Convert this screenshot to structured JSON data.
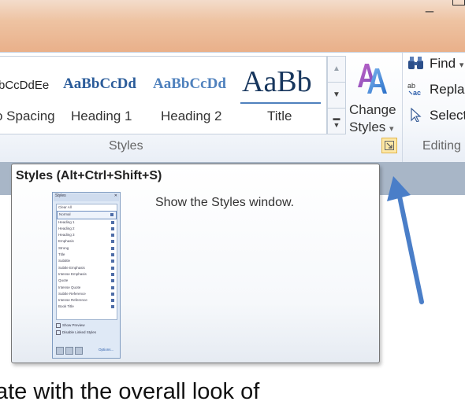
{
  "ribbon": {
    "style_gallery": [
      {
        "sample": "bCcDdEe",
        "label": "o Spacing"
      },
      {
        "sample": "AaBbCcDd",
        "label": "Heading 1"
      },
      {
        "sample": "AaBbCcDd",
        "label": "Heading 2"
      },
      {
        "sample": "AaBb",
        "label": "Title"
      }
    ],
    "change_styles": {
      "line1": "Change",
      "line2": "Styles",
      "dropdown": "▾"
    },
    "styles_group_label": "Styles",
    "editing": {
      "find": "Find",
      "find_dropdown": "▾",
      "replace": "Repla",
      "select": "Select",
      "group_label": "Editing"
    }
  },
  "tooltip": {
    "title": "Styles (Alt+Ctrl+Shift+S)",
    "description": "Show the Styles window.",
    "thumbnail": {
      "header": "Styles",
      "rows": [
        "Clear All",
        "Normal",
        "Heading 1",
        "Heading 2",
        "Heading 3",
        "Emphasis",
        "Strong",
        "Title",
        "Subtitle",
        "Subtle Emphasis",
        "Intense Emphasis",
        "Quote",
        "Intense Quote",
        "Subtle Reference",
        "Intense Reference",
        "Book Title"
      ],
      "option_preview": "Show Preview",
      "option_linked": "Disable Linked Styles",
      "options_link": "Options..."
    }
  },
  "document": {
    "visible_text": "ate with the overall look of"
  },
  "colors": {
    "heading1": "#2b5c9a",
    "heading2": "#4f81bd",
    "title": "#17365d",
    "arrow": "#4a7ec8",
    "launcher_highlight": "#fde8a6"
  }
}
